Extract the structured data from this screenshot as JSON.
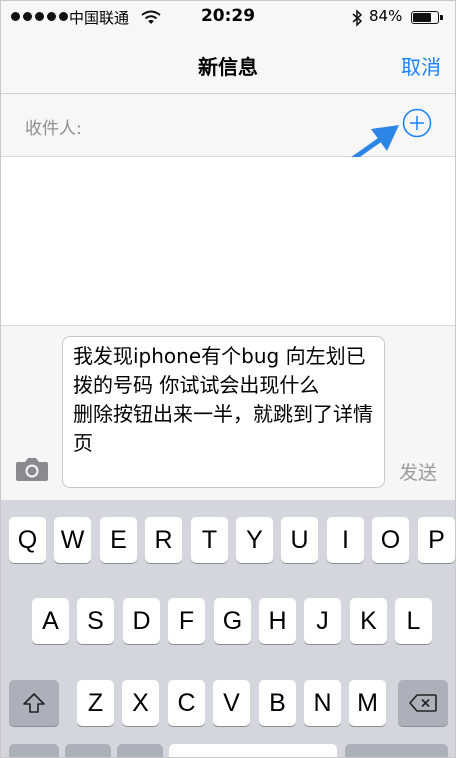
{
  "status_bar": {
    "carrier": "中国联通",
    "time": "20:29",
    "battery_text": "84%",
    "battery_level": 0.84,
    "signal_dots": 5
  },
  "nav": {
    "title": "新信息",
    "cancel_label": "取消"
  },
  "recipient": {
    "label": "收件人:",
    "value": ""
  },
  "compose": {
    "message": "我发现iphone有个bug 向左划已拨的号码 你试试会出现什么\n删除按钮出来一半，就跳到了详情页",
    "send_label": "发送"
  },
  "icons": {
    "camera": "camera-icon",
    "add_contact": "plus-circle-icon",
    "arrow": "annotation-arrow-icon",
    "shift": "shift-icon",
    "backspace": "backspace-icon"
  },
  "colors": {
    "accent": "#1a82fb",
    "keyboard_bg": "#d3d6dc",
    "function_key": "#abb0ba",
    "annotation_arrow": "#2b86e8"
  },
  "keyboard": {
    "row1": [
      "Q",
      "W",
      "E",
      "R",
      "T",
      "Y",
      "U",
      "I",
      "O",
      "P"
    ],
    "row2": [
      "A",
      "S",
      "D",
      "F",
      "G",
      "H",
      "J",
      "K",
      "L"
    ],
    "row3": [
      "Z",
      "X",
      "C",
      "V",
      "B",
      "N",
      "M"
    ]
  }
}
